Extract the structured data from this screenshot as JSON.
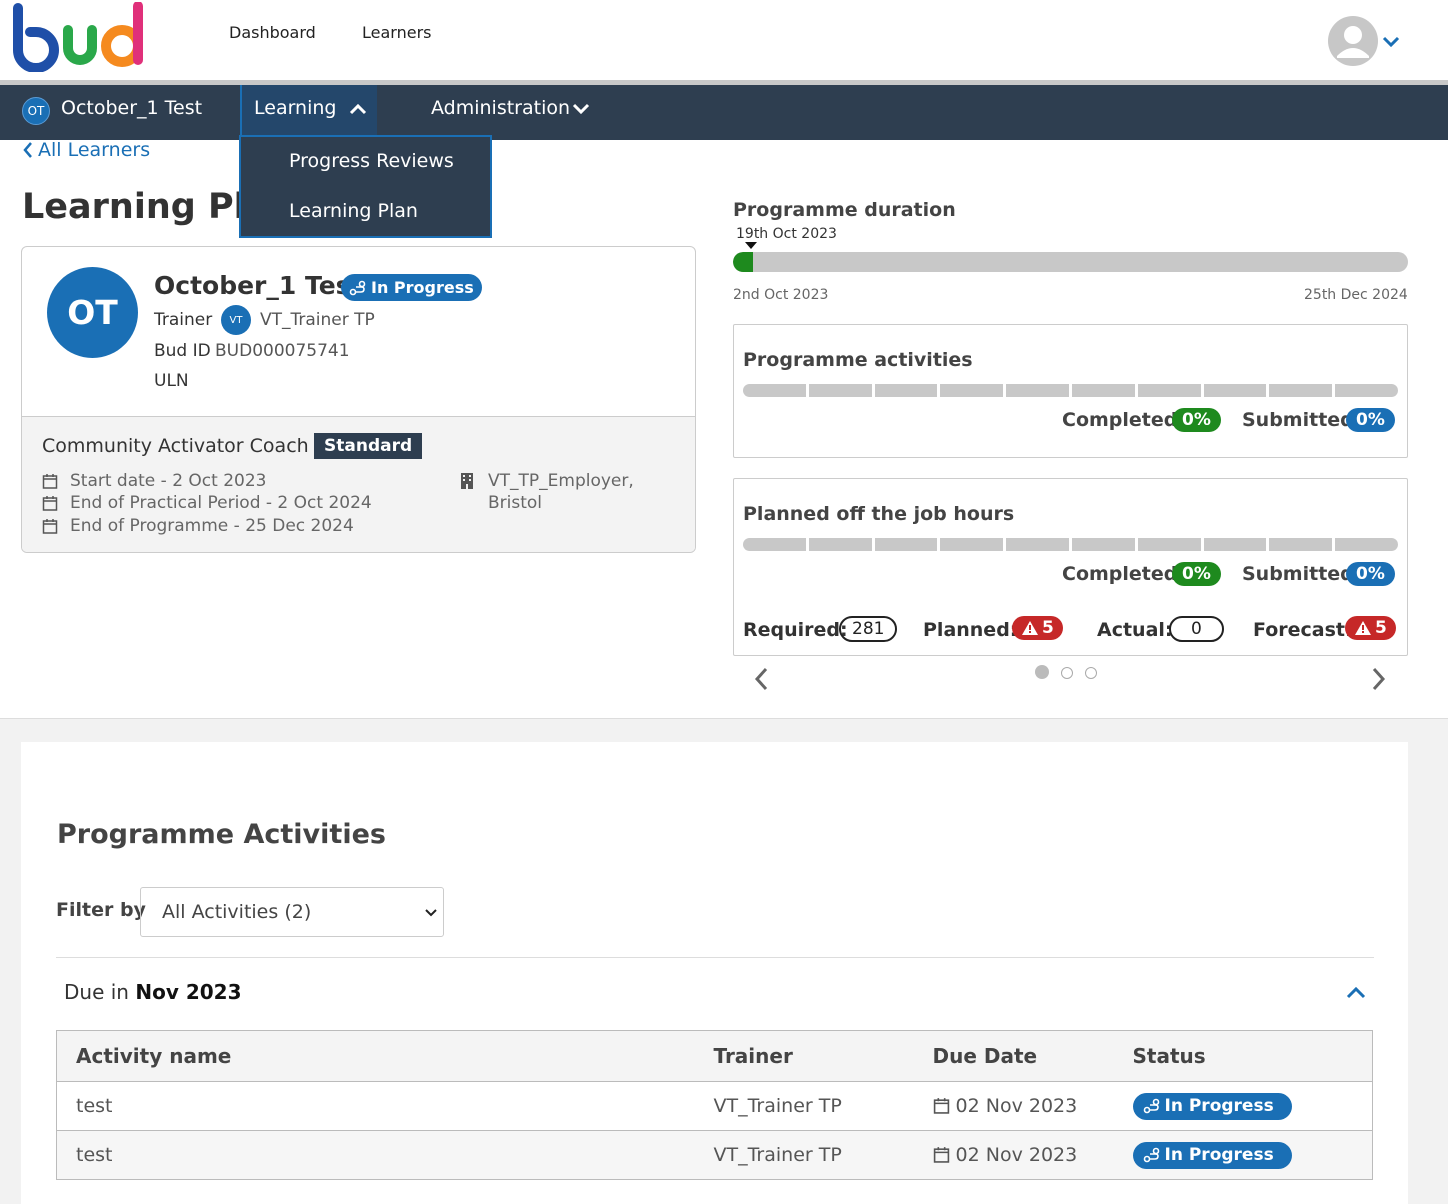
{
  "header": {
    "logo_text": "bud",
    "nav": [
      "Dashboard",
      "Learners"
    ]
  },
  "subnav": {
    "learner_initials": "OT",
    "learner_name": "October_1 Test",
    "learning_label": "Learning",
    "administration_label": "Administration",
    "dropdown": [
      "Progress Reviews",
      "Learning Plan"
    ]
  },
  "back_link": "All Learners",
  "page_title": "Learning Plan",
  "learner": {
    "initials": "OT",
    "name": "October_1 Test",
    "status": "In Progress",
    "trainer_label": "Trainer",
    "trainer_initials": "VT",
    "trainer_name": "VT_Trainer TP",
    "bud_id_label": "Bud ID",
    "bud_id": "BUD000075741",
    "uln_label": "ULN",
    "programme": "Community Activator Coach",
    "programme_badge": "Standard",
    "dates": [
      "Start date - 2 Oct 2023",
      "End of Practical Period - 2 Oct 2024",
      "End of Programme - 25 Dec 2024"
    ],
    "employer_line1": "VT_TP_Employer,",
    "employer_line2": "Bristol"
  },
  "duration": {
    "title": "Programme duration",
    "marker_label": "19th Oct 2023",
    "start": "2nd Oct 2023",
    "end": "25th Dec 2024",
    "progress_fraction": 0.03
  },
  "activities_card": {
    "title": "Programme activities",
    "completed_label": "Completed",
    "completed_value": "0%",
    "submitted_label": "Submitted",
    "submitted_value": "0%"
  },
  "hours_card": {
    "title": "Planned off the job hours",
    "completed_label": "Completed",
    "completed_value": "0%",
    "submitted_label": "Submitted",
    "submitted_value": "0%",
    "required_label": "Required:",
    "required_value": "281",
    "planned_label": "Planned:",
    "planned_value": "5",
    "actual_label": "Actual:",
    "actual_value": "0",
    "forecast_label": "Forecast:",
    "forecast_value": "5"
  },
  "section": {
    "title": "Programme Activities",
    "filter_label": "Filter by",
    "filter_value": "All Activities (2)",
    "group_prefix": "Due in",
    "group_month": "Nov 2023"
  },
  "table": {
    "headers": [
      "Activity name",
      "Trainer",
      "Due Date",
      "Status"
    ],
    "rows": [
      {
        "name": "test",
        "trainer": "VT_Trainer TP",
        "due": "02 Nov 2023",
        "status": "In Progress"
      },
      {
        "name": "test",
        "trainer": "VT_Trainer TP",
        "due": "02 Nov 2023",
        "status": "In Progress"
      }
    ]
  },
  "colors": {
    "navy": "#2e3e50",
    "blue": "#1a6fb5",
    "green": "#1e8a1e",
    "red": "#c62828"
  }
}
